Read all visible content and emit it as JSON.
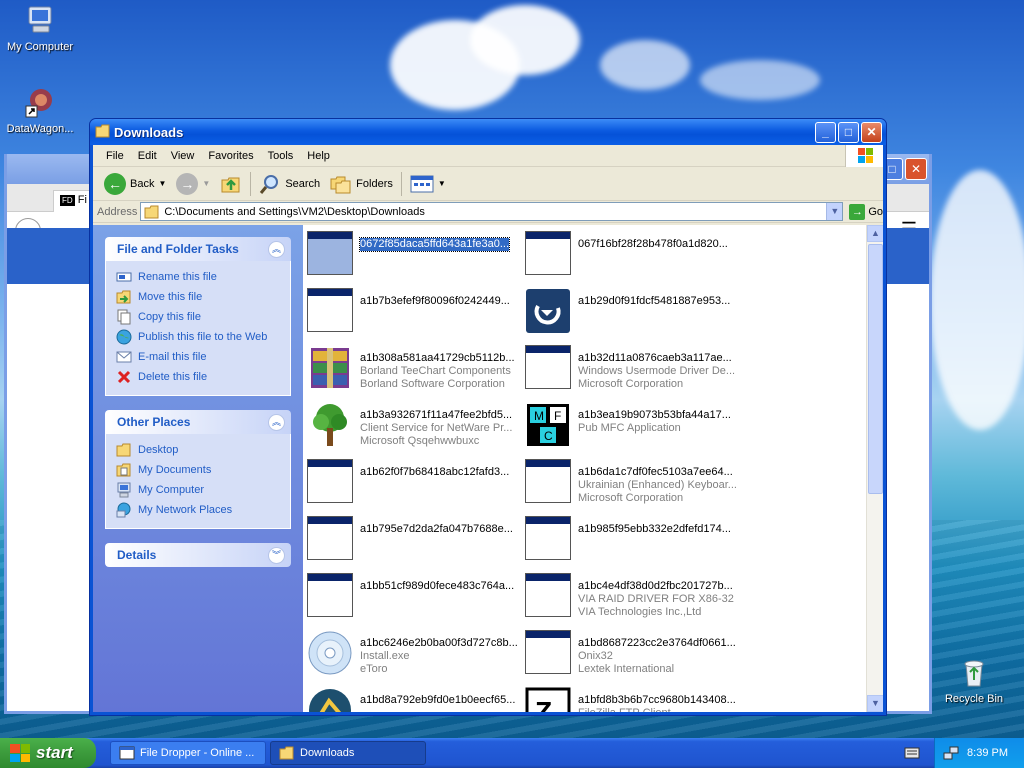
{
  "desktop": {
    "icons": [
      {
        "label": "My Computer"
      },
      {
        "label": "DataWagon..."
      },
      {
        "label": "Recycle Bin"
      }
    ]
  },
  "background_window": {
    "tab_label": "Fi",
    "tab_icon_text": "FD"
  },
  "explorer": {
    "title": "Downloads",
    "menu": [
      "File",
      "Edit",
      "View",
      "Favorites",
      "Tools",
      "Help"
    ],
    "toolbar": {
      "back": "Back",
      "search": "Search",
      "folders": "Folders"
    },
    "address": {
      "label": "Address",
      "value": "C:\\Documents and Settings\\VM2\\Desktop\\Downloads",
      "go": "Go"
    },
    "tasks_panel": {
      "file_folder_tasks": {
        "title": "File and Folder Tasks",
        "items": [
          "Rename this file",
          "Move this file",
          "Copy this file",
          "Publish this file to the Web",
          "E-mail this file",
          "Delete this file"
        ]
      },
      "other_places": {
        "title": "Other Places",
        "items": [
          "Desktop",
          "My Documents",
          "My Computer",
          "My Network Places"
        ]
      },
      "details": {
        "title": "Details"
      }
    },
    "files": [
      {
        "name": "0672f85daca5ffd643a1fe3a0...",
        "line2": "",
        "line3": "",
        "icon": "app-window-icon",
        "selected": true
      },
      {
        "name": "067f16bf28f28b478f0a1d820...",
        "line2": "",
        "line3": "",
        "icon": "app-window-icon"
      },
      {
        "name": "a1b7b3efef9f80096f0242449...",
        "line2": "",
        "line3": "",
        "icon": "app-window-icon"
      },
      {
        "name": "a1b29d0f91fdcf5481887e953...",
        "line2": "",
        "line3": "",
        "icon": "setup-arrow-icon"
      },
      {
        "name": "a1b308a581aa41729cb5112b...",
        "line2": "Borland TeeChart Components",
        "line3": "Borland Software Corporation",
        "icon": "winrar-archive-icon"
      },
      {
        "name": "a1b32d11a0876caeb3a117ae...",
        "line2": "Windows Usermode Driver De...",
        "line3": "Microsoft Corporation",
        "icon": "app-window-icon"
      },
      {
        "name": "a1b3a932671f11a47fee2bfd5...",
        "line2": "Client Service for NetWare Pr...",
        "line3": "Microsoft Qsqehwwbuxc",
        "icon": "tree-icon"
      },
      {
        "name": "a1b3ea19b9073b53bfa44a17...",
        "line2": "Pub MFC Application",
        "line3": "",
        "icon": "mfc-cubes-icon"
      },
      {
        "name": "a1b62f0f7b68418abc12fafd3...",
        "line2": "",
        "line3": "",
        "icon": "app-window-icon"
      },
      {
        "name": "a1b6da1c7df0fec5103a7ee64...",
        "line2": "Ukrainian (Enhanced) Keyboar...",
        "line3": "Microsoft Corporation",
        "icon": "app-window-icon"
      },
      {
        "name": "a1b795e7d2da2fa047b7688e...",
        "line2": "",
        "line3": "",
        "icon": "app-window-icon"
      },
      {
        "name": "a1b985f95ebb332e2dfefd174...",
        "line2": "",
        "line3": "",
        "icon": "app-window-icon"
      },
      {
        "name": "a1bb51cf989d0fece483c764a...",
        "line2": "",
        "line3": "",
        "icon": "app-window-icon"
      },
      {
        "name": "a1bc4e4df38d0d2fbc201727b...",
        "line2": "VIA RAID DRIVER FOR X86-32",
        "line3": "VIA Technologies Inc.,Ltd",
        "icon": "app-window-icon"
      },
      {
        "name": "a1bc6246e2b0ba00f3d727c8b...",
        "line2": "Install.exe",
        "line3": "eToro",
        "icon": "cd-disc-icon"
      },
      {
        "name": "a1bd8687223cc2e3764df0661...",
        "line2": "Onix32",
        "line3": "Lextek International",
        "icon": "app-window-icon"
      },
      {
        "name": "a1bd8a792eb9fd0e1b0eecf65...",
        "line2": "",
        "line3": "",
        "icon": "installer-icon"
      },
      {
        "name": "a1bfd8b3b6b7cc9680b143408...",
        "line2": "FileZilla FTP Client",
        "line3": "",
        "icon": "filezilla-icon"
      }
    ]
  },
  "taskbar": {
    "start": "start",
    "tasks": [
      "File Dropper - Online ...",
      "Downloads"
    ],
    "clock": "8:39 PM"
  },
  "colors": {
    "xp_blue": "#0a53d4",
    "task_link": "#215dc6",
    "selection": "#316ac5",
    "start_green": "#3c9b3c"
  }
}
